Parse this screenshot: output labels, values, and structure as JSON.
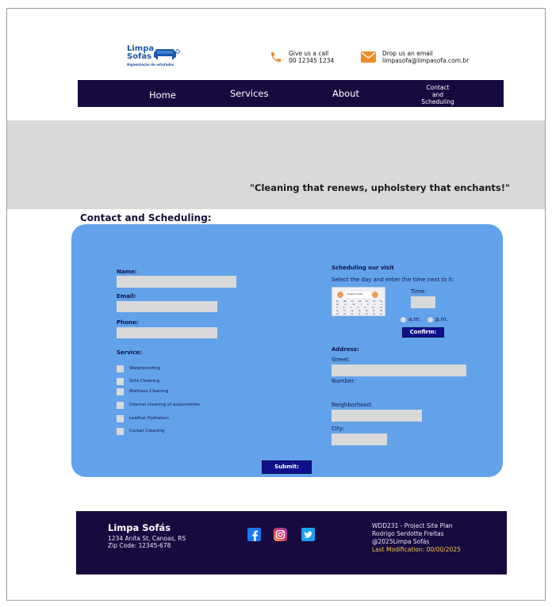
{
  "logo": {
    "line1": "Limpa",
    "line2": "Sofás",
    "tagline": "Higienização de estofados"
  },
  "header": {
    "call_label": "Give us a call",
    "call_number": "00 12345 1234",
    "email_label": "Drop us an email",
    "email_address": "limpasofa@limpasofa.com.br",
    "call_icon_color": "#f08a24",
    "mail_icon_color": "#f08a24"
  },
  "nav": {
    "home": "Home",
    "services": "Services",
    "about": "About",
    "contact_l1": "Contact",
    "contact_l2": "and",
    "contact_l3": "Scheduling"
  },
  "hero": {
    "tagline": "\"Cleaning that renews, upholstery that enchants!\""
  },
  "contact_section": {
    "title": "Contact and Scheduling:"
  },
  "form": {
    "name_label": "Name:",
    "email_label": "Email:",
    "phone_label": "Phone:",
    "service_label": "Service:",
    "services": [
      "Waterproofing",
      "Sofa Cleaning",
      "Mattress Cleaning",
      "Internal cleaning of automobiles",
      "Leather Hydration",
      "Carpet Cleaning"
    ],
    "schedule_title": "Scheduling our visit",
    "schedule_hint": "Select the day and enter the time next to it:",
    "calendar_month": "MARCH 2025",
    "calendar_days": [
      "SU",
      "MO",
      "TU",
      "WE",
      "TH",
      "FR",
      "SA"
    ],
    "time_label": "Time:",
    "am_label": "a.m.",
    "pm_label": "p.m.",
    "confirm_label": "Confirm:",
    "address_label": "Address:",
    "street_label": "Street:",
    "number_label": "Number:",
    "neighborhood_label": "Neighborhood:",
    "city_label": "City:",
    "submit_label": "Submit:"
  },
  "footer": {
    "name": "Limpa Sofás",
    "address_l1": "1234 Anita St, Canoas, RS",
    "address_l2": "Zip Code: 12345-678",
    "right_l1": "WDD231 - Project Site Plan",
    "right_l2": "Rodrigo Serdotte Freitas",
    "right_l3": "@2025Limpa Sofás",
    "right_l4": "Last Modification: 00/00/2025",
    "facebook_color": "#1877f2",
    "instagram_color": "#e1306c",
    "twitter_color": "#1da1f2"
  }
}
